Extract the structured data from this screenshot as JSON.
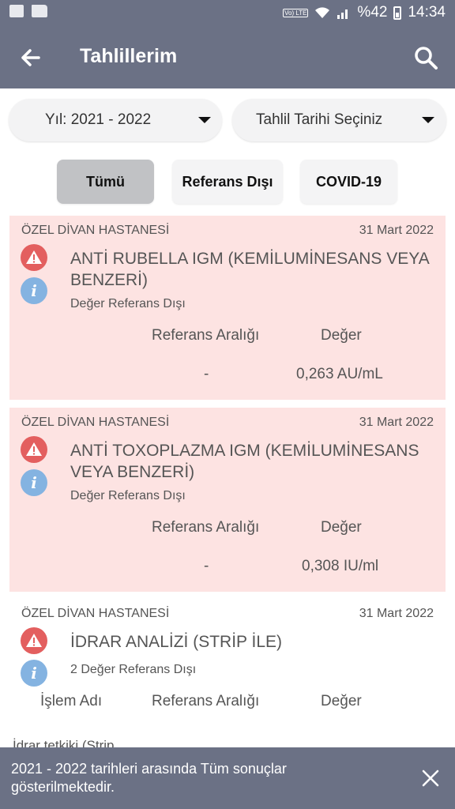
{
  "status_bar": {
    "battery_percent": "%42",
    "time": "14:34",
    "network_badge": "Vo) LTE"
  },
  "app_bar": {
    "title": "Tahlillerim"
  },
  "dropdowns": {
    "year": "Yıl: 2021 - 2022",
    "date": "Tahlil Tarihi Seçiniz"
  },
  "filters": [
    {
      "label": "Tümü",
      "active": true
    },
    {
      "label": "Referans Dışı",
      "active": false
    },
    {
      "label": "COVID-19",
      "active": false
    }
  ],
  "results": [
    {
      "hospital": "ÖZEL DİVAN HASTANESİ",
      "date": "31 Mart 2022",
      "name": "ANTİ RUBELLA IGM (KEMİLUMİNESANS VEYA BENZERİ)",
      "status": "Değer Referans Dışı",
      "ref_label": "Referans Aralığı",
      "value_label": "Değer",
      "ref_value": "-",
      "value": "0,263 AU/mL"
    },
    {
      "hospital": "ÖZEL DİVAN HASTANESİ",
      "date": "31 Mart 2022",
      "name": "ANTİ TOXOPLAZMA IGM (KEMİLUMİNESANS VEYA BENZERİ)",
      "status": "Değer Referans Dışı",
      "ref_label": "Referans Aralığı",
      "value_label": "Değer",
      "ref_value": "-",
      "value": "0,308 IU/ml"
    },
    {
      "hospital": "ÖZEL DİVAN HASTANESİ",
      "date": "31 Mart 2022",
      "name": "İDRAR ANALİZİ (STRİP İLE)",
      "status": "2 Değer Referans Dışı",
      "proc_label": "İşlem Adı",
      "ref_label": "Referans Aralığı",
      "value_label": "Değer",
      "peek_row": "İdrar tetkiki (Strip"
    }
  ],
  "snackbar": {
    "message": "2021 - 2022 tarihleri arasında Tüm sonuçlar gösterilmektedir."
  },
  "colors": {
    "primary": "#6b7185",
    "alert_bg": "#fde3e2",
    "warning_red": "#e35f5f",
    "info_blue": "#84b3e1",
    "active_filter": "#c1c2c5"
  },
  "icons": [
    "chat-icon",
    "folder-icon",
    "wifi-icon",
    "signal-icon",
    "battery-icon",
    "back-arrow-icon",
    "search-icon",
    "caret-down-icon",
    "warning-icon",
    "info-icon",
    "close-icon"
  ]
}
